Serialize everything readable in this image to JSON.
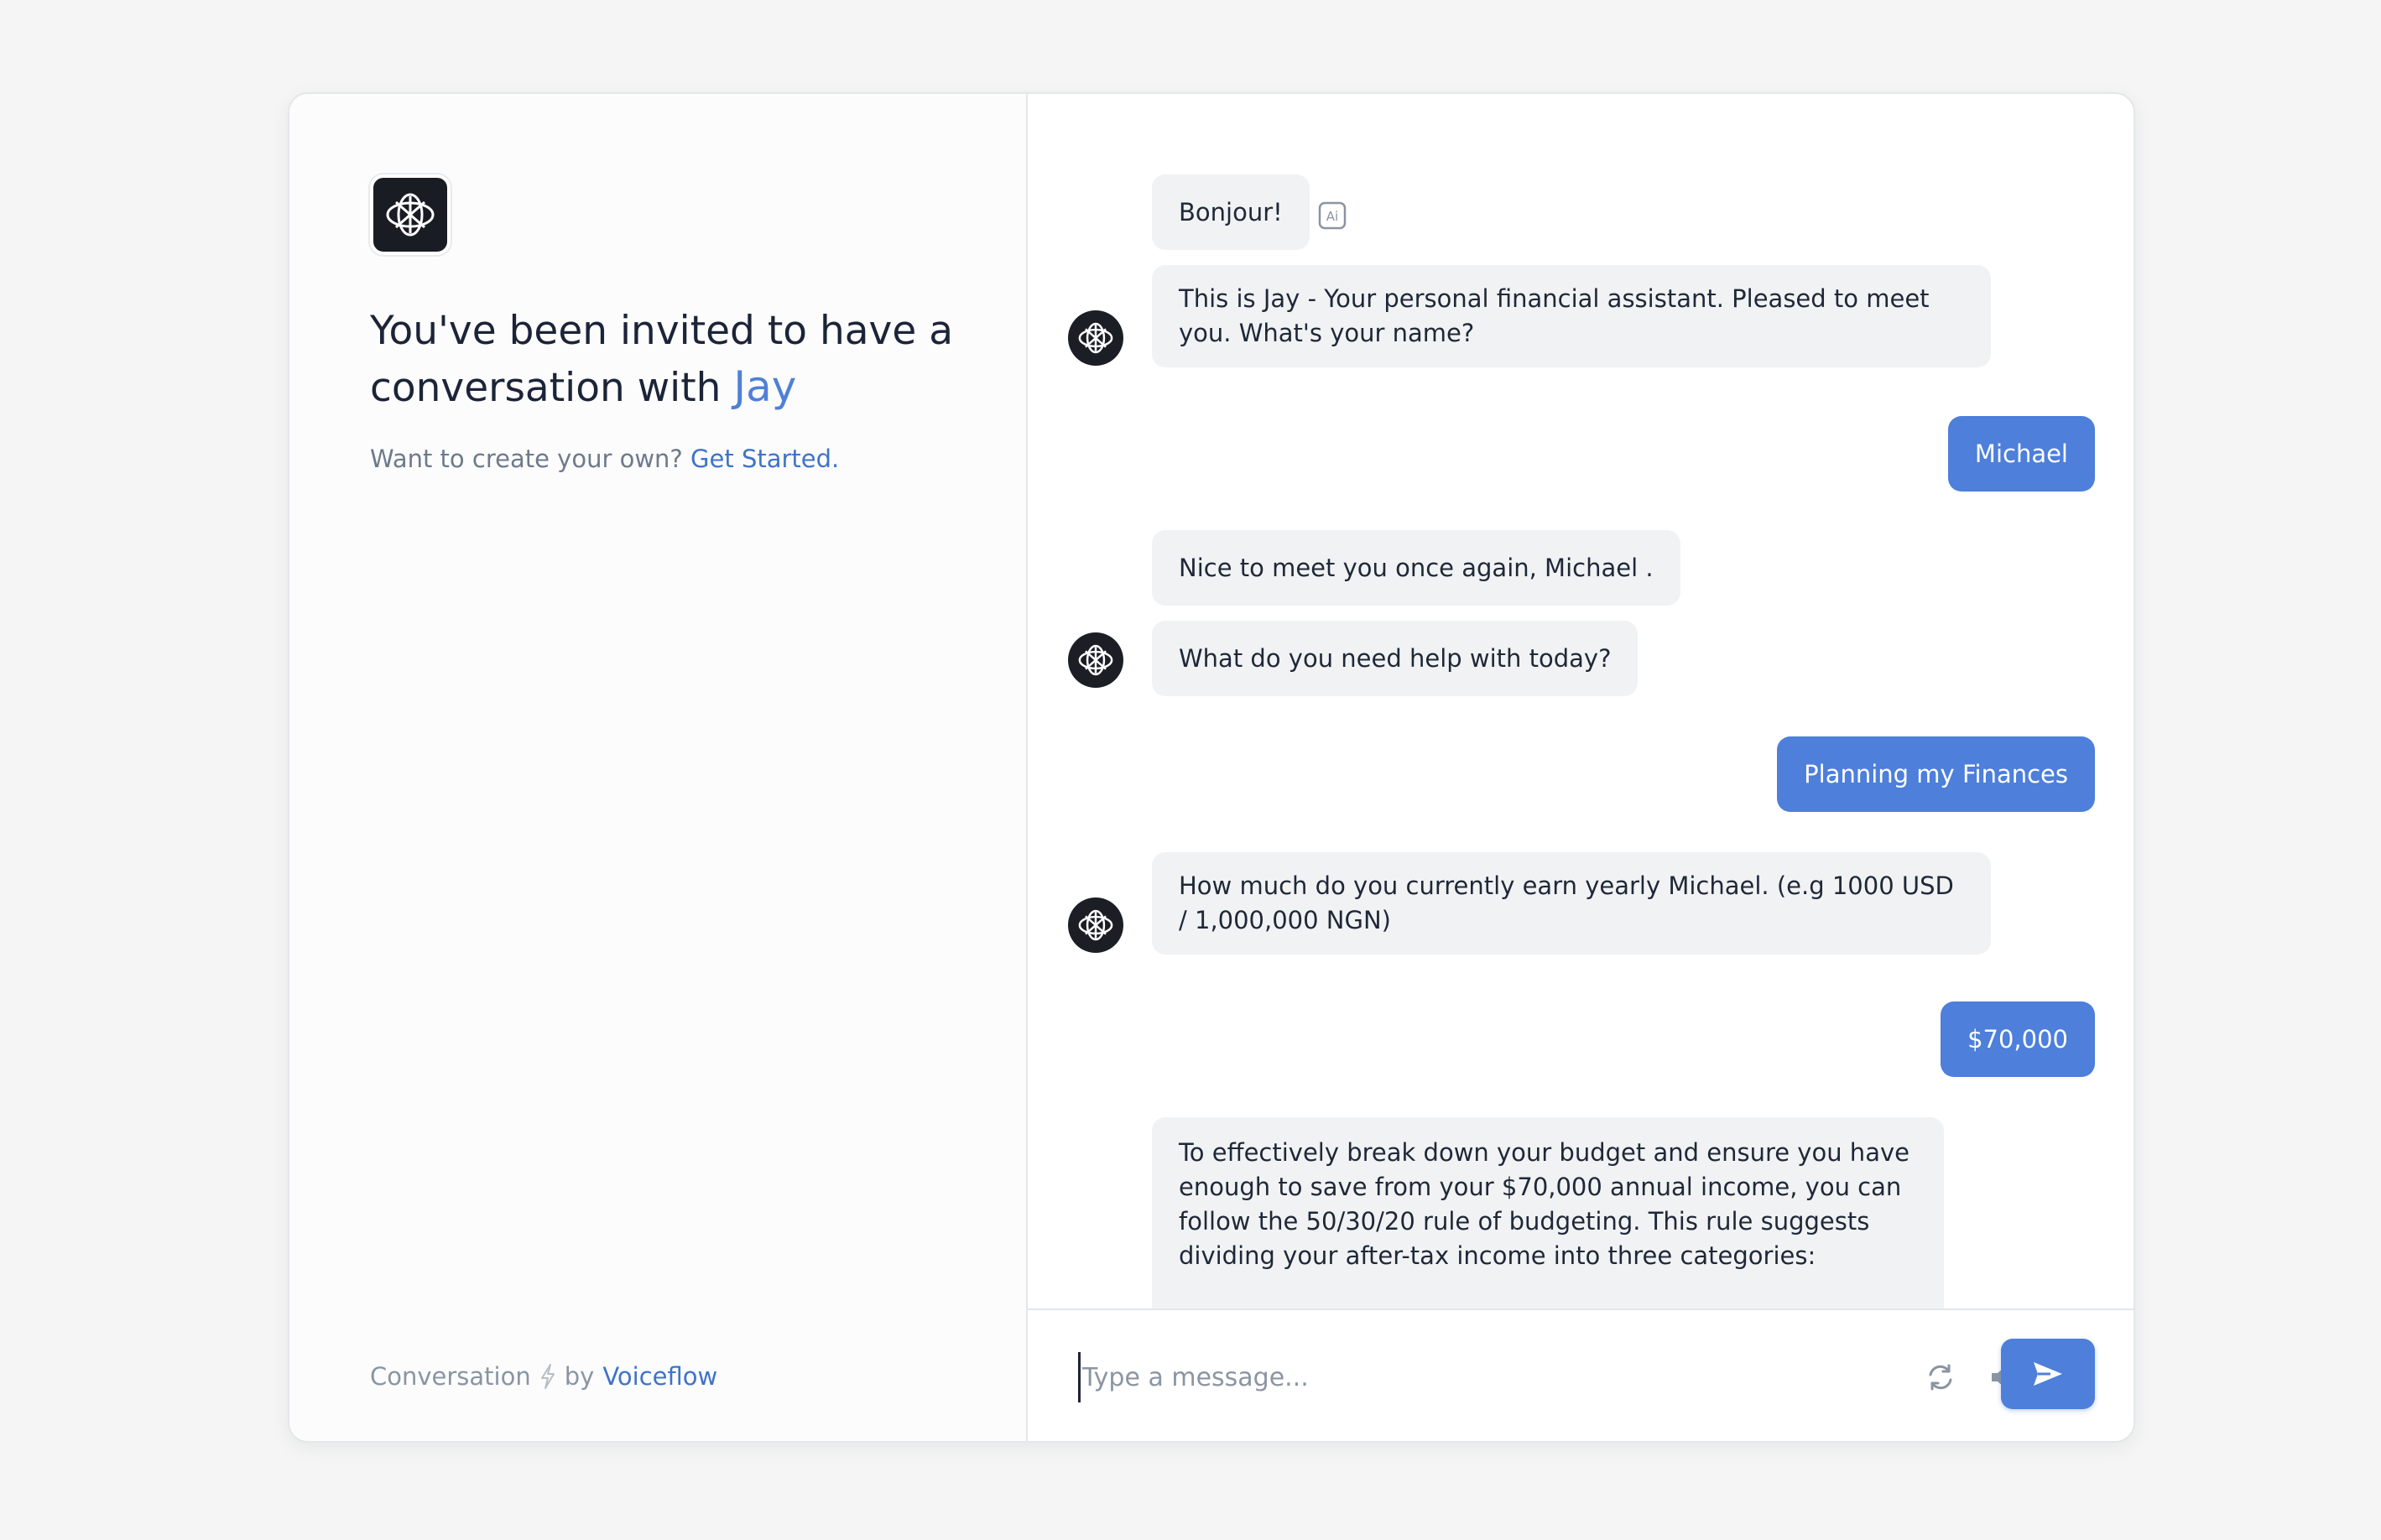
{
  "sidebar": {
    "heading_prefix": "You've been invited to have a conversation with",
    "assistant_name": "Jay",
    "subline_prefix": "Want to create your own?",
    "subline_link": "Get Started.",
    "footer_prefix": "Conversation",
    "footer_by": "by",
    "footer_link": "Voiceflow"
  },
  "chat": {
    "messages": [
      {
        "from": "bot",
        "text": "Bonjour!"
      },
      {
        "from": "bot",
        "text": "This is Jay - Your personal financial assistant. Pleased to meet you. What's your name?"
      },
      {
        "from": "user",
        "text": "Michael"
      },
      {
        "from": "bot",
        "text": "Nice to meet you once again, Michael ."
      },
      {
        "from": "bot",
        "text": "What do you need help with today?"
      },
      {
        "from": "user",
        "text": "Planning my Finances"
      },
      {
        "from": "bot",
        "text": "How much do you currently earn yearly Michael. (e.g 1000 USD / 1,000,000 NGN)"
      },
      {
        "from": "user",
        "text": "$70,000"
      },
      {
        "from": "bot",
        "text": "To effectively break down your budget and ensure you have enough to save from your $70,000 annual income, you can follow the 50/30/20 rule of budgeting. This rule suggests dividing your after-tax income into three categories:"
      }
    ],
    "ai_badge": "Ai"
  },
  "composer": {
    "placeholder": "Type a message...",
    "refresh_icon": "refresh-icon",
    "mute_icon": "speaker-muted-icon",
    "send_icon": "send-icon"
  },
  "colors": {
    "accent": "#4d7fdb",
    "bot_bubble": "#f1f2f3",
    "avatar": "#1b1e25"
  }
}
